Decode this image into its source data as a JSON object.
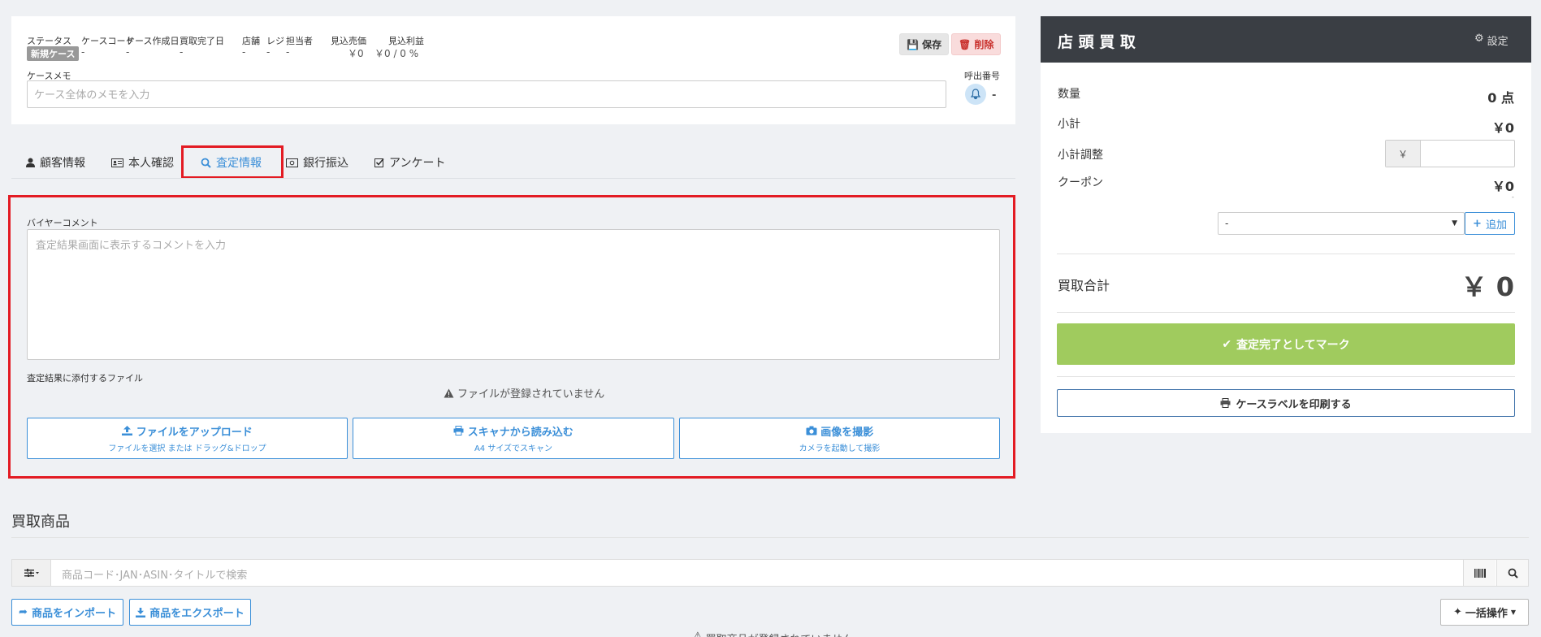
{
  "case": {
    "meta": [
      {
        "label": "ステータス",
        "value": "新規ケース"
      },
      {
        "label": "ケースコード",
        "value": "-"
      },
      {
        "label": "ケース作成日",
        "value": "-"
      },
      {
        "label": "買取完了日",
        "value": "-"
      },
      {
        "label": "店舗",
        "value": "-"
      },
      {
        "label": "レジ",
        "value": "-"
      },
      {
        "label": "担当者",
        "value": "-"
      },
      {
        "label": "見込売価",
        "value": "￥0"
      },
      {
        "label": "見込利益",
        "value": "￥0 / 0 %"
      }
    ],
    "save_label": "保存",
    "delete_label": "削除",
    "memo_label": "ケースメモ",
    "memo_placeholder": "ケース全体のメモを入力",
    "call_number_label": "呼出番号",
    "call_number_value": "-"
  },
  "tabs": [
    {
      "label": "顧客情報",
      "icon": "user-icon"
    },
    {
      "label": "本人確認",
      "icon": "id-card-icon"
    },
    {
      "label": "査定情報",
      "icon": "search-icon",
      "active": true
    },
    {
      "label": "銀行振込",
      "icon": "money-icon"
    },
    {
      "label": "アンケート",
      "icon": "check-square-icon"
    }
  ],
  "assessment": {
    "buyer_comment_label": "バイヤーコメント",
    "buyer_comment_placeholder": "査定結果画面に表示するコメントを入力",
    "attach_label": "査定結果に添付するファイル",
    "no_file_message": "ファイルが登録されていません",
    "buttons": [
      {
        "title": "ファイルをアップロード",
        "sub": "ファイルを選択 または ドラッグ&ドロップ",
        "icon": "upload-icon"
      },
      {
        "title": "スキャナから読み込む",
        "sub": "A4 サイズでスキャン",
        "icon": "print-icon"
      },
      {
        "title": "画像を撮影",
        "sub": "カメラを起動して撮影",
        "icon": "camera-icon"
      }
    ]
  },
  "buy_items": {
    "title": "買取商品",
    "search_placeholder": "商品コード･JAN･ASIN･タイトルで検索",
    "import_label": "商品をインポート",
    "export_label": "商品をエクスポート",
    "bulk_label": "一括操作",
    "empty_message": "買取商品が登録されていません"
  },
  "store_buy": {
    "title": "店 頭 買 取",
    "settings_label": "設定",
    "quantity_label": "数量",
    "quantity_value": "0 点",
    "subtotal_label": "小計",
    "subtotal_value": "￥0",
    "adjust_label": "小計調整",
    "adjust_prefix": "￥",
    "coupon_label": "クーポン",
    "coupon_value": "￥0",
    "coupon_note": "-",
    "coupon_select_value": "-",
    "add_label": "追加",
    "total_label": "買取合計",
    "total_value": "￥ 0",
    "complete_label": "査定完了としてマーク",
    "print_label": "ケースラベルを印刷する"
  }
}
